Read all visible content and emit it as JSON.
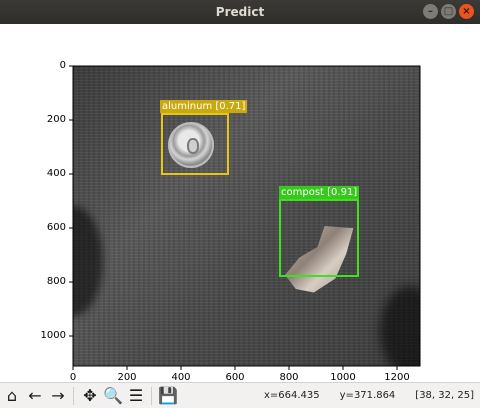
{
  "window": {
    "title": "Predict",
    "buttons": [
      "minimize",
      "maximize",
      "close"
    ]
  },
  "plot": {
    "y_ticks": [
      "0",
      "200",
      "400",
      "600",
      "800",
      "1000"
    ],
    "x_ticks": [
      "0",
      "200",
      "400",
      "600",
      "800",
      "1000",
      "1200"
    ],
    "detections": [
      {
        "label": "aluminum [0.71]",
        "color": "#e6c619"
      },
      {
        "label": "compost [0.91]",
        "color": "#3ee021"
      }
    ]
  },
  "toolbar": {
    "icons": [
      "home-icon",
      "back-icon",
      "forward-icon",
      "pan-icon",
      "zoom-icon",
      "configure-subplots-icon",
      "save-icon"
    ]
  },
  "status": {
    "x": "x=664.435",
    "y": "y=371.864",
    "rgb": "[38, 32, 25]"
  }
}
